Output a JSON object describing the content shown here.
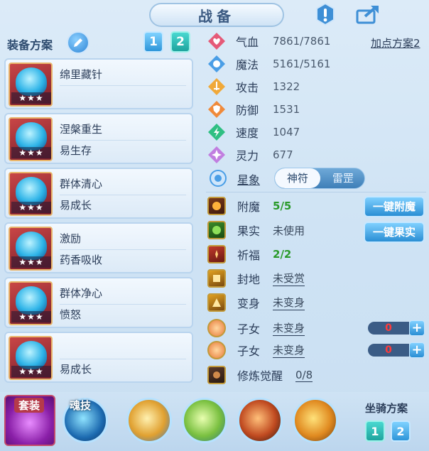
{
  "header": {
    "title": "战备",
    "icons": [
      "exclamation-icon",
      "share-icon"
    ]
  },
  "equip": {
    "label": "装备方案",
    "scheme_buttons": [
      "1",
      "2"
    ],
    "active_scheme": "2",
    "slots": [
      {
        "line1": "绵里藏针",
        "line2": "",
        "stars": "★★★"
      },
      {
        "line1": "涅槃重生",
        "line2": "易生存",
        "stars": "★★★"
      },
      {
        "line1": "群体清心",
        "line2": "易成长",
        "stars": "★★★"
      },
      {
        "line1": "激励",
        "line2": "药香吸收",
        "stars": "★★★"
      },
      {
        "line1": "群体净心",
        "line2": "愤怒",
        "stars": "★★★"
      },
      {
        "line1": "",
        "line2": "易成长",
        "stars": "★★★"
      }
    ]
  },
  "stats": {
    "plan_link": "加点方案2",
    "items": [
      {
        "label": "气血",
        "value": "7861/7861",
        "color": "#e55a78"
      },
      {
        "label": "魔法",
        "value": "5161/5161",
        "color": "#4a9ee6"
      },
      {
        "label": "攻击",
        "value": "1322",
        "color": "#f0a93a"
      },
      {
        "label": "防御",
        "value": "1531",
        "color": "#f08a3a"
      },
      {
        "label": "速度",
        "value": "1047",
        "color": "#2fbf83"
      },
      {
        "label": "灵力",
        "value": "677",
        "color": "#c17ee0"
      }
    ],
    "xingxiang": {
      "label": "星象",
      "options": [
        "神符",
        "雷罡"
      ],
      "selected": "神符"
    }
  },
  "buffs": [
    {
      "label": "附魔",
      "value": "5/5",
      "style": "green"
    },
    {
      "label": "果实",
      "value": "未使用",
      "style": "plain"
    },
    {
      "label": "祈福",
      "value": "2/2",
      "style": "green"
    },
    {
      "label": "封地",
      "value": "未受赏",
      "style": "underline"
    },
    {
      "label": "变身",
      "value": "未变身",
      "style": "underline"
    },
    {
      "label": "子女",
      "value": "未变身",
      "style": "underline"
    },
    {
      "label": "子女",
      "value": "未变身",
      "style": "underline"
    },
    {
      "label": "修炼觉醒",
      "value": "0/8",
      "style": "underline"
    }
  ],
  "actions": {
    "enchant": "一键附魔",
    "fruit": "一键果实"
  },
  "steppers": [
    "0",
    "0"
  ],
  "bottom": {
    "suit_label": "套装",
    "skill_label": "魂技",
    "mount_label": "坐骑方案",
    "mount_buttons": [
      "1",
      "2"
    ]
  }
}
